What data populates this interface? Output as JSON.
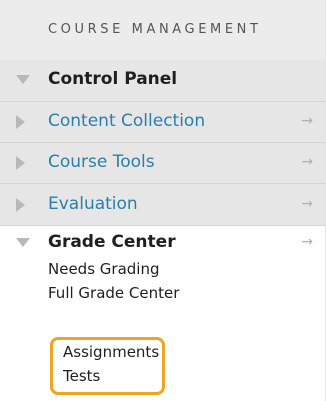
{
  "section": {
    "title": "COURSE MANAGEMENT"
  },
  "menu": {
    "control_panel": {
      "label": "Control Panel",
      "expanded": true
    },
    "content_collection": {
      "label": "Content Collection",
      "arrow": "→"
    },
    "course_tools": {
      "label": "Course Tools",
      "arrow": "→"
    },
    "evaluation": {
      "label": "Evaluation",
      "arrow": "→"
    },
    "grade_center": {
      "label": "Grade Center",
      "arrow": "→",
      "expanded": true,
      "items": [
        {
          "label": "Needs Grading"
        },
        {
          "label": "Full Grade Center"
        },
        {
          "label": "Assignments"
        },
        {
          "label": "Tests"
        }
      ]
    }
  },
  "colors": {
    "link": "#2a7faa",
    "highlight": "#f0a424",
    "header_bg": "#ececec",
    "row_bg": "#e6e6e6"
  }
}
